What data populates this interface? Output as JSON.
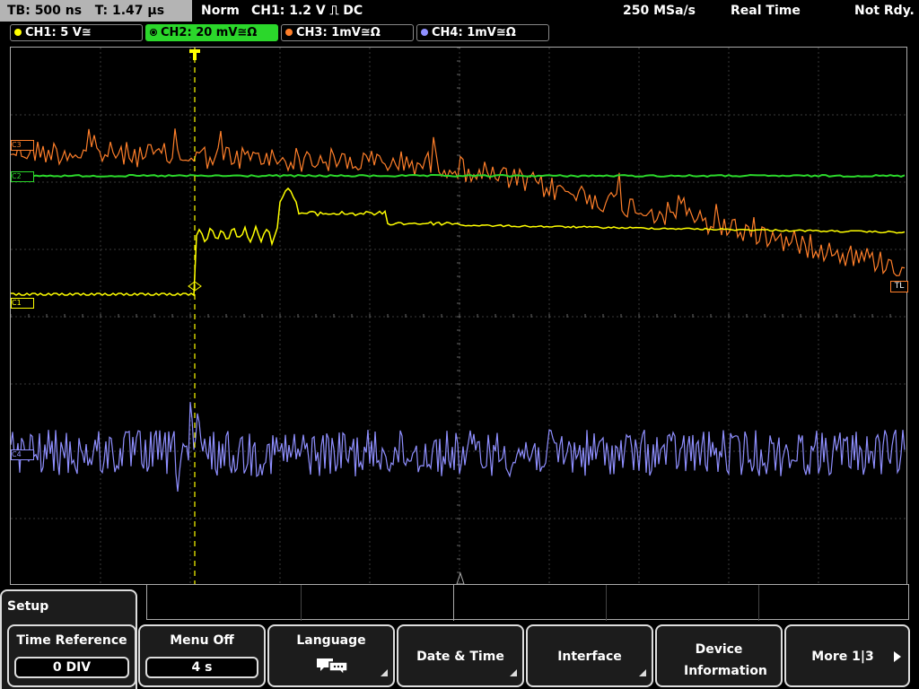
{
  "status": {
    "timebase": "TB: 500 ns",
    "trigger_time": "T: 1.47 µs",
    "mode": "Norm",
    "trigger": "CH1: 1.2 V ⎍ DC",
    "sample_rate": "250 MSa/s",
    "acq_mode": "Real Time",
    "state": "Not Rdy."
  },
  "channels": [
    {
      "label": "CH1: 5 V≅",
      "color": "#ffff00"
    },
    {
      "label": "CH2: 20 mV≅Ω",
      "color": "#2bd72b"
    },
    {
      "label": "CH3: 1mV≅Ω",
      "color": "#ff7f2a"
    },
    {
      "label": "CH4: 1mV≅Ω",
      "color": "#8f8fff"
    }
  ],
  "markers": {
    "c1": "C1",
    "c2": "C2",
    "c3": "C3",
    "c4": "C4",
    "trigger_level": "TL",
    "trigger_pos": "T"
  },
  "menu": {
    "title": "Setup",
    "softkeys": [
      {
        "label": "Time Reference",
        "value": "0 DIV"
      },
      {
        "label": "Menu Off",
        "value": "4 s"
      },
      {
        "label": "Language",
        "icon": "speech-bubbles-icon"
      },
      {
        "label": "Date & Time"
      },
      {
        "label": "Interface"
      },
      {
        "label": "Device Information"
      },
      {
        "label": "More 1|3"
      }
    ]
  }
}
